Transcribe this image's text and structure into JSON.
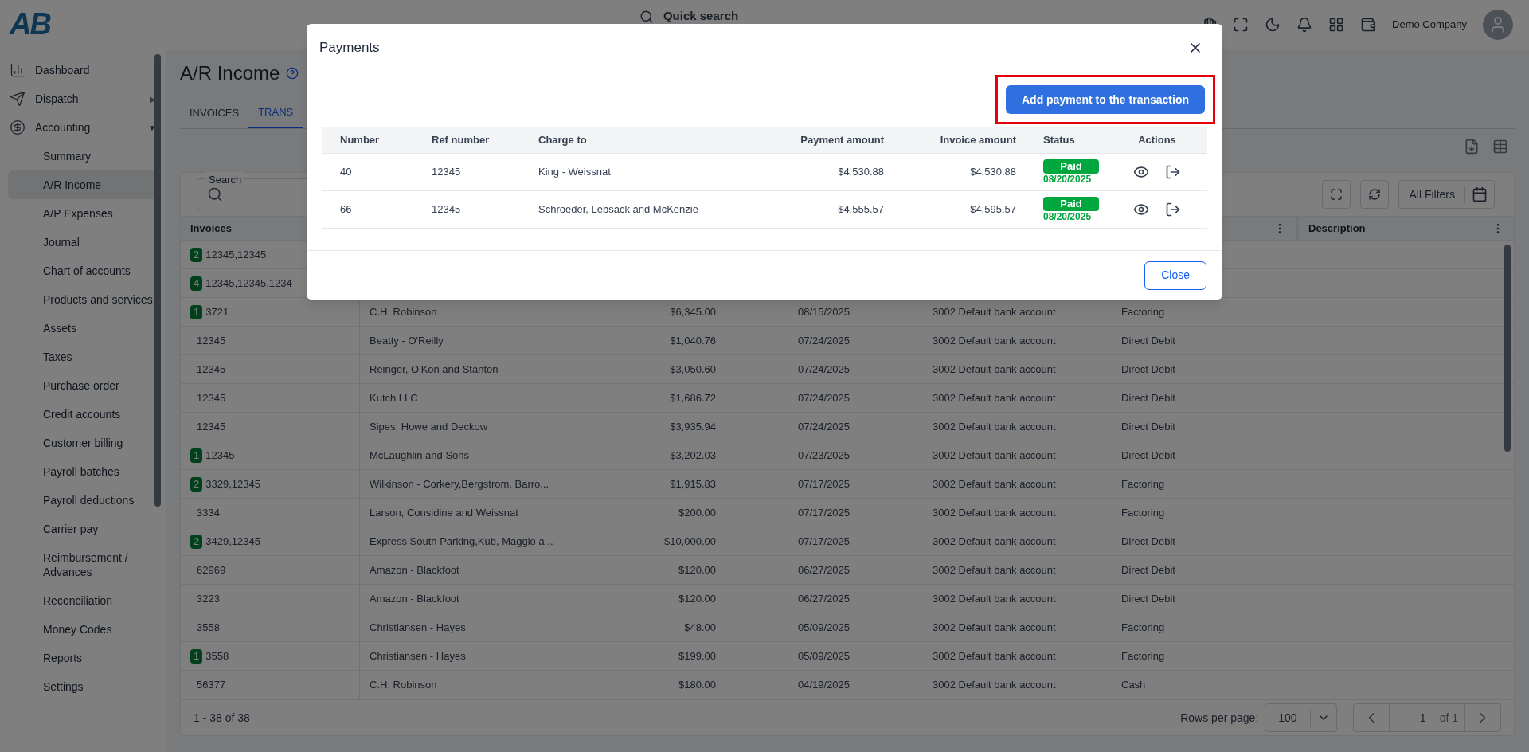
{
  "header": {
    "logo": "AB",
    "search_placeholder": "Quick search",
    "company": "Demo Company"
  },
  "sidebar": {
    "items": [
      {
        "label": "Dashboard",
        "selected": false
      },
      {
        "label": "Dispatch",
        "caret": "▶",
        "expanded": false,
        "selected": false
      },
      {
        "label": "Accounting",
        "caret": "▼",
        "expanded": true,
        "selected": false,
        "children": [
          {
            "label": "Summary",
            "selected": false
          },
          {
            "label": "A/R Income",
            "selected": true
          },
          {
            "label": "A/P Expenses",
            "selected": false
          },
          {
            "label": "Journal",
            "selected": false
          },
          {
            "label": "Chart of accounts",
            "selected": false
          },
          {
            "label": "Products and services",
            "selected": false
          },
          {
            "label": "Assets",
            "selected": false
          },
          {
            "label": "Taxes",
            "selected": false
          },
          {
            "label": "Purchase order",
            "selected": false
          },
          {
            "label": "Credit accounts",
            "selected": false
          },
          {
            "label": "Customer billing",
            "selected": false
          },
          {
            "label": "Payroll batches",
            "selected": false
          },
          {
            "label": "Payroll deductions",
            "selected": false
          },
          {
            "label": "Carrier pay",
            "selected": false
          },
          {
            "label": "Reimbursement / Advances",
            "selected": false
          },
          {
            "label": "Reconciliation",
            "selected": false
          },
          {
            "label": "Money Codes",
            "selected": false
          },
          {
            "label": "Reports",
            "selected": false
          },
          {
            "label": "Settings",
            "selected": false
          }
        ]
      }
    ]
  },
  "page": {
    "title": "A/R Income",
    "tabs": [
      {
        "label": "INVOICES",
        "selected": false
      },
      {
        "label": "TRANS",
        "selected": true
      }
    ]
  },
  "toolbar": {
    "search_label": "Search",
    "filters_label": "All Filters"
  },
  "table": {
    "columns": [
      {
        "label": "Invoices"
      },
      {},
      {},
      {},
      {},
      {
        "menu": true
      },
      {
        "label": "Description",
        "menu": true
      }
    ],
    "rows": [
      {
        "count": "2",
        "invoices": "12345,12345"
      },
      {
        "count": "4",
        "invoices": "12345,12345,1234"
      },
      {
        "count": "1",
        "invoices": "3721",
        "charge_to": "C.H. Robinson",
        "amount": "$6,345.00",
        "date": "08/15/2025",
        "account": "3002 Default bank account",
        "type": "Factoring"
      },
      {
        "invoices": "12345",
        "charge_to": "Beatty - O'Reilly",
        "amount": "$1,040.76",
        "date": "07/24/2025",
        "account": "3002 Default bank account",
        "type": "Direct Debit"
      },
      {
        "invoices": "12345",
        "charge_to": "Reinger, O'Kon and Stanton",
        "amount": "$3,050.60",
        "date": "07/24/2025",
        "account": "3002 Default bank account",
        "type": "Direct Debit"
      },
      {
        "invoices": "12345",
        "charge_to": "Kutch LLC",
        "amount": "$1,686.72",
        "date": "07/24/2025",
        "account": "3002 Default bank account",
        "type": "Direct Debit"
      },
      {
        "invoices": "12345",
        "charge_to": "Sipes, Howe and Deckow",
        "amount": "$3,935.94",
        "date": "07/24/2025",
        "account": "3002 Default bank account",
        "type": "Direct Debit"
      },
      {
        "count": "1",
        "invoices": "12345",
        "charge_to": "McLaughlin and Sons",
        "amount": "$3,202.03",
        "date": "07/23/2025",
        "account": "3002 Default bank account",
        "type": "Direct Debit"
      },
      {
        "count": "2",
        "invoices": "3329,12345",
        "charge_to": "Wilkinson - Corkery,Bergstrom, Barro...",
        "amount": "$1,915.83",
        "date": "07/17/2025",
        "account": "3002 Default bank account",
        "type": "Factoring"
      },
      {
        "invoices": "3334",
        "charge_to": "Larson, Considine and Weissnat",
        "amount": "$200.00",
        "date": "07/17/2025",
        "account": "3002 Default bank account",
        "type": "Factoring"
      },
      {
        "count": "2",
        "invoices": "3429,12345",
        "charge_to": "Express South Parking,Kub, Maggio a...",
        "amount": "$10,000.00",
        "date": "07/17/2025",
        "account": "3002 Default bank account",
        "type": "Direct Debit"
      },
      {
        "invoices": "62969",
        "charge_to": "Amazon - Blackfoot",
        "amount": "$120.00",
        "date": "06/27/2025",
        "account": "3002 Default bank account",
        "type": "Direct Debit"
      },
      {
        "invoices": "3223",
        "charge_to": "Amazon - Blackfoot",
        "amount": "$120.00",
        "date": "06/27/2025",
        "account": "3002 Default bank account",
        "type": "Direct Debit"
      },
      {
        "invoices": "3558",
        "charge_to": "Christiansen - Hayes",
        "amount": "$48.00",
        "date": "05/09/2025",
        "account": "3002 Default bank account",
        "type": "Factoring"
      },
      {
        "count": "1",
        "invoices": "3558",
        "charge_to": "Christiansen - Hayes",
        "amount": "$199.00",
        "date": "05/09/2025",
        "account": "3002 Default bank account",
        "type": "Factoring"
      },
      {
        "invoices": "56377",
        "charge_to": "C.H. Robinson",
        "amount": "$180.00",
        "date": "04/19/2025",
        "account": "3002 Default bank account",
        "type": "Cash"
      }
    ]
  },
  "footer": {
    "range": "1 - 38 of 38",
    "rows_per_page_label": "Rows per page:",
    "rows_per_page": "100",
    "page": "1",
    "of_pages": "of 1"
  },
  "modal": {
    "title": "Payments",
    "add_button": "Add payment to the transaction",
    "highlighted": true,
    "columns": [
      "Number",
      "Ref number",
      "Charge to",
      "Payment amount",
      "Invoice amount",
      "Status",
      "Actions"
    ],
    "rows": [
      {
        "number": "40",
        "ref": "12345",
        "charge_to": "King - Weissnat",
        "payment": "$4,530.88",
        "invoice": "$4,530.88",
        "status": {
          "kind": "paid",
          "label": "Paid",
          "date": "08/20/2025"
        }
      },
      {
        "number": "66",
        "ref": "12345",
        "charge_to": "Schroeder, Lebsack and McKenzie",
        "payment": "$4,555.57",
        "invoice": "$4,595.57",
        "status": {
          "kind": "paid",
          "label": "Paid",
          "date": "08/20/2025"
        }
      }
    ],
    "close_button": "Close"
  }
}
